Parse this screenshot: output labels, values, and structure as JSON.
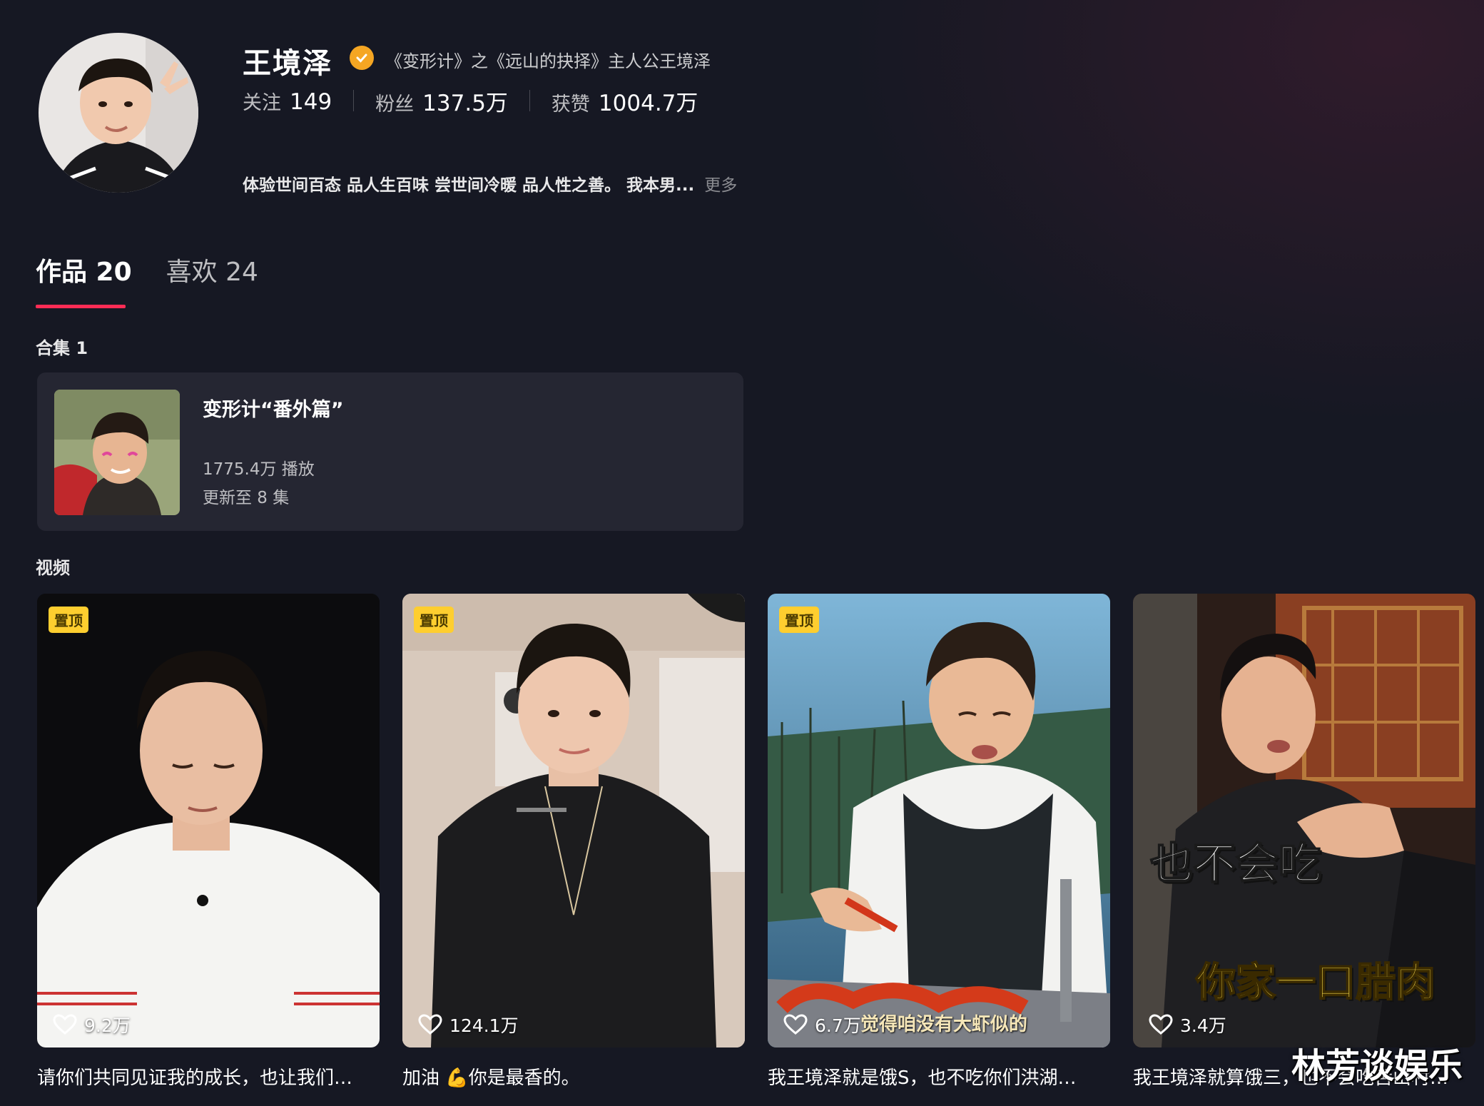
{
  "profile": {
    "name": "王境泽",
    "verify_text": "《变形计》之《远山的抉择》主人公王境泽",
    "stats": [
      {
        "label": "关注",
        "value": "149"
      },
      {
        "label": "粉丝",
        "value": "137.5万"
      },
      {
        "label": "获赞",
        "value": "1004.7万"
      }
    ],
    "bio": "体验世间百态 品人生百味 尝世间冷暖 品人性之善。 我本男...",
    "bio_more": "更多"
  },
  "tabs": [
    {
      "label": "作品 20",
      "active": true
    },
    {
      "label": "喜欢 24",
      "active": false
    }
  ],
  "collections": {
    "label": "合集 1",
    "item": {
      "title": "变形计“番外篇”",
      "plays": "1775.4万 播放",
      "update": "更新至 8 集"
    }
  },
  "videos_label": "视频",
  "videos": [
    {
      "pinned": true,
      "pin_label": "置顶",
      "likes": "9.2万",
      "caption": "请你们共同见证我的成长，也让我们…",
      "bg": "#0b0b0d"
    },
    {
      "pinned": true,
      "pin_label": "置顶",
      "likes": "124.1万",
      "caption": "加油 💪你是最香的。",
      "bg": "#c9b7a8"
    },
    {
      "pinned": true,
      "pin_label": "置顶",
      "likes": "6.7万",
      "caption": "我王境泽就是饿S，也不吃你们洪湖…",
      "bg": "#4a7fa4",
      "subtitle": "觉得咱没有大虾似的"
    },
    {
      "pinned": false,
      "pin_label": "",
      "likes": "3.4万",
      "caption": "我王境泽就算饿三，也不会吃舌山村…",
      "bg": "#2a1c18",
      "subtitle1": "也不会吃",
      "subtitle2": "你家一口腊肉"
    }
  ],
  "watermark": "林芳谈娱乐"
}
